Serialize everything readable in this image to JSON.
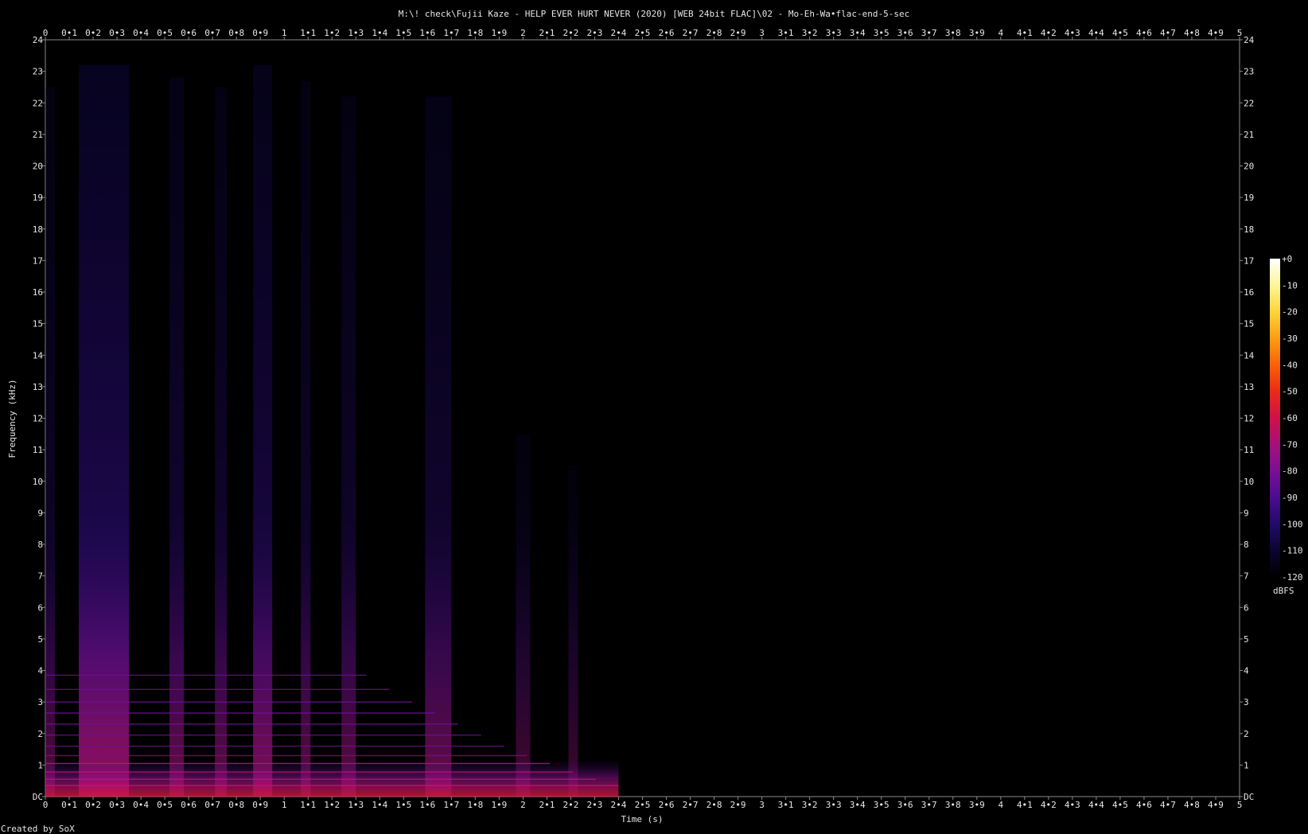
{
  "chart_data": {
    "type": "heatmap",
    "title": "M:\\! check\\Fujii Kaze - HELP EVER HURT NEVER (2020) [WEB 24bit FLAC]\\02 - Mo-Eh-Wa•flac-end-5-sec",
    "xlabel": "Time (s)",
    "ylabel": "Frequency (kHz)",
    "xlim": [
      0,
      5
    ],
    "ylim": [
      0,
      24
    ],
    "x_ticks": [
      "0",
      "0•1",
      "0•2",
      "0•3",
      "0•4",
      "0•5",
      "0•6",
      "0•7",
      "0•8",
      "0•9",
      "1",
      "1•1",
      "1•2",
      "1•3",
      "1•4",
      "1•5",
      "1•6",
      "1•7",
      "1•8",
      "1•9",
      "2",
      "2•1",
      "2•2",
      "2•3",
      "2•4",
      "2•5",
      "2•6",
      "2•7",
      "2•8",
      "2•9",
      "3",
      "3•1",
      "3•2",
      "3•3",
      "3•4",
      "3•5",
      "3•6",
      "3•7",
      "3•8",
      "3•9",
      "4",
      "4•1",
      "4•2",
      "4•3",
      "4•4",
      "4•5",
      "4•6",
      "4•7",
      "4•8",
      "4•9",
      "5"
    ],
    "y_ticks": [
      "DC",
      "1",
      "2",
      "3",
      "4",
      "5",
      "6",
      "7",
      "8",
      "9",
      "10",
      "11",
      "12",
      "13",
      "14",
      "15",
      "16",
      "17",
      "18",
      "19",
      "20",
      "21",
      "22",
      "23",
      "24"
    ],
    "colorbar": {
      "label": "dBFS",
      "ticks": [
        "+0",
        "-10",
        "-20",
        "-30",
        "-40",
        "-50",
        "-60",
        "-70",
        "-80",
        "-90",
        "-100",
        "-110",
        "-120"
      ],
      "range": [
        -120,
        0
      ],
      "colors": [
        "#000000",
        "#0b0530",
        "#220a6a",
        "#4b0c8f",
        "#7a0f94",
        "#a5117a",
        "#cf1148",
        "#ec2a14",
        "#f9620a",
        "#fc9d14",
        "#fdd53a",
        "#fef59a",
        "#ffffff"
      ]
    },
    "energy_bursts": [
      {
        "start": 0.0,
        "end": 0.04,
        "top_khz": 22.5,
        "level_db": -100
      },
      {
        "start": 0.14,
        "end": 0.35,
        "top_khz": 23.2,
        "level_db": -80
      },
      {
        "start": 0.52,
        "end": 0.58,
        "top_khz": 22.8,
        "level_db": -95
      },
      {
        "start": 0.71,
        "end": 0.76,
        "top_khz": 22.5,
        "level_db": -97
      },
      {
        "start": 0.87,
        "end": 0.95,
        "top_khz": 23.2,
        "level_db": -88
      },
      {
        "start": 1.07,
        "end": 1.11,
        "top_khz": 22.7,
        "level_db": -98
      },
      {
        "start": 1.24,
        "end": 1.3,
        "top_khz": 22.2,
        "level_db": -98
      },
      {
        "start": 1.59,
        "end": 1.7,
        "top_khz": 22.2,
        "level_db": -95
      },
      {
        "start": 1.97,
        "end": 2.03,
        "top_khz": 11.5,
        "level_db": -104
      },
      {
        "start": 2.19,
        "end": 2.23,
        "top_khz": 10.5,
        "level_db": -106
      }
    ],
    "harmonic_bands_khz": [
      0.35,
      0.55,
      0.78,
      1.05,
      1.3,
      1.6,
      1.95,
      2.3,
      2.65,
      3.0,
      3.4,
      3.85
    ],
    "signal_end_s": 2.4
  },
  "footer": {
    "credit": "Created by SoX"
  }
}
